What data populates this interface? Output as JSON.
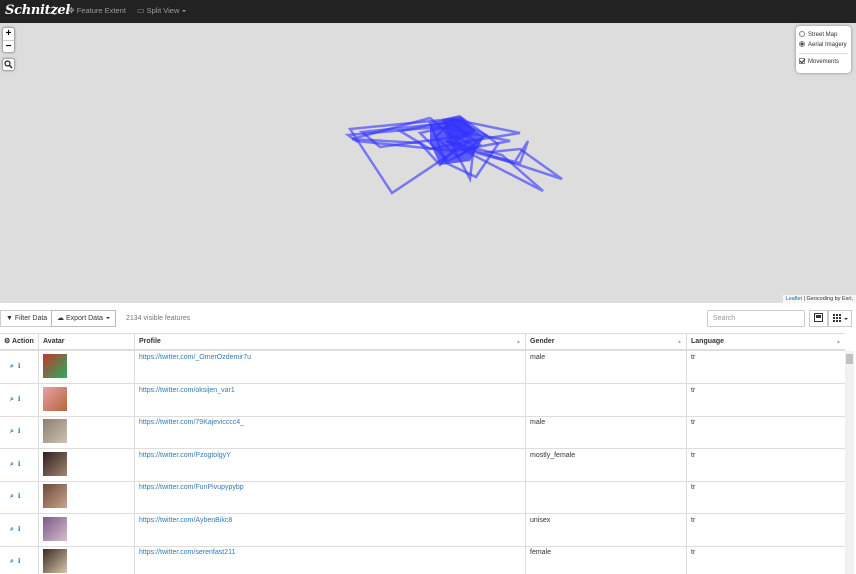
{
  "navbar": {
    "brand": "Schnitzel",
    "feature_extent": "Feature Extent",
    "split_view": "Split View"
  },
  "map": {
    "zoom_in": "+",
    "zoom_out": "−",
    "layers": {
      "street_map": "Street Map",
      "aerial_imagery": "Aerial Imagery",
      "movements": "Movements"
    },
    "attribution_leaflet": "Leaflet",
    "attribution_rest": "| Geocoding by Esri,",
    "line_color": "#3333ff"
  },
  "toolbar": {
    "filter_data": "Filter Data",
    "export_data": "Export Data",
    "visible_features": "2134 visible features",
    "search_placeholder": "Search"
  },
  "table": {
    "columns": [
      "Action",
      "Avatar",
      "Profile",
      "Gender",
      "Language"
    ],
    "rows": [
      {
        "profile": "https://twitter.com/_OmerOzdemir7u",
        "gender": "male",
        "language": "tr"
      },
      {
        "profile": "https://twitter.com/oksijen_var1",
        "gender": "",
        "language": "tr"
      },
      {
        "profile": "https://twitter.com/79Kajevicccc4_",
        "gender": "male",
        "language": "tr"
      },
      {
        "profile": "https://twitter.com/PzogtolgyY",
        "gender": "mostly_female",
        "language": "tr"
      },
      {
        "profile": "https://twitter.com/FunPivupypybp",
        "gender": "",
        "language": "tr"
      },
      {
        "profile": "https://twitter.com/AybenBikc8",
        "gender": "unisex",
        "language": "tr"
      },
      {
        "profile": "https://twitter.com/serenfast211",
        "gender": "female",
        "language": "tr"
      }
    ]
  }
}
